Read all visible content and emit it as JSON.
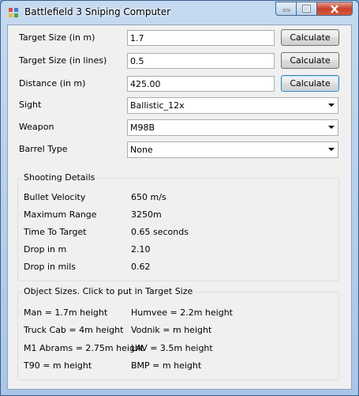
{
  "window": {
    "title": "Battlefield 3 Sniping Computer"
  },
  "form": {
    "target_size_m": {
      "label": "Target Size (in m)",
      "value": "1.7",
      "button": "Calculate"
    },
    "target_size_lines": {
      "label": "Target Size (in lines)",
      "value": "0.5",
      "button": "Calculate"
    },
    "distance": {
      "label": "Distance (in m)",
      "value": "425.00",
      "button": "Calculate"
    },
    "sight": {
      "label": "Sight",
      "value": "Ballistic_12x"
    },
    "weapon": {
      "label": "Weapon",
      "value": "M98B"
    },
    "barrel": {
      "label": "Barrel Type",
      "value": "None"
    }
  },
  "shooting": {
    "title": "Shooting Details",
    "rows": [
      {
        "label": "Bullet Velocity",
        "value": "650 m/s"
      },
      {
        "label": "Maximum Range",
        "value": "3250m"
      },
      {
        "label": "Time To Target",
        "value": "0.65 seconds"
      },
      {
        "label": "Drop in m",
        "value": "2.10"
      },
      {
        "label": "Drop in mils",
        "value": "0.62"
      }
    ]
  },
  "objects": {
    "title": "Object Sizes. Click to put in Target Size",
    "items": [
      "Man = 1.7m height",
      "Humvee = 2.2m height",
      "Truck Cab = 4m height",
      "Vodnik = m height",
      "M1 Abrams = 2.75m height",
      "LAV = 3.5m height",
      "T90 = m height",
      "BMP = m height"
    ]
  }
}
